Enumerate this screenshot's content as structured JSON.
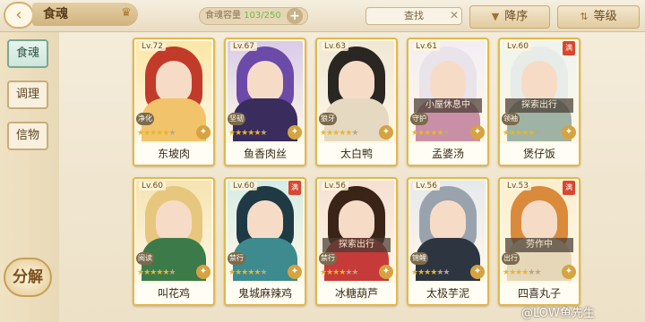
{
  "header": {
    "title": "食魂",
    "capacity_label": "食魂容量",
    "capacity_value": "103/250",
    "search_label": "查找",
    "sort_desc_label": "降序",
    "sort_level_label": "等级"
  },
  "sidebar": {
    "items": [
      {
        "label": "食魂",
        "active": true
      },
      {
        "label": "调理",
        "active": false
      },
      {
        "label": "信物",
        "active": false
      }
    ],
    "decompose_label": "分解"
  },
  "cards": [
    {
      "level": "Lv.72",
      "name": "东坡肉",
      "role": "净化",
      "status": "",
      "tag": "",
      "stars_filled": 5
    },
    {
      "level": "Lv.67",
      "name": "鱼香肉丝",
      "role": "坚韧",
      "status": "",
      "tag": "",
      "stars_filled": 5
    },
    {
      "level": "Lv.63",
      "name": "太白鸭",
      "role": "狼牙",
      "status": "",
      "tag": "",
      "stars_filled": 5
    },
    {
      "level": "Lv.61",
      "name": "孟婆汤",
      "role": "守护",
      "status": "小屋休息中",
      "tag": "",
      "stars_filled": 5
    },
    {
      "level": "Lv.60",
      "name": "煲仔饭",
      "role": "领袖",
      "status": "探索出行",
      "tag": "满",
      "stars_filled": 5
    },
    {
      "level": "Lv.60",
      "name": "叫花鸡",
      "role": "阅读",
      "status": "",
      "tag": "",
      "stars_filled": 5
    },
    {
      "level": "Lv.60",
      "name": "鬼城麻辣鸡",
      "role": "禁行",
      "status": "",
      "tag": "满",
      "stars_filled": 5
    },
    {
      "level": "Lv.56",
      "name": "冰糖葫芦",
      "role": "禁行",
      "status": "探索出行",
      "tag": "",
      "stars_filled": 4
    },
    {
      "level": "Lv.56",
      "name": "太极芋泥",
      "role": "锦鲤",
      "status": "",
      "tag": "",
      "stars_filled": 4
    },
    {
      "level": "Lv.53",
      "name": "四喜丸子",
      "role": "出行",
      "status": "劳作中",
      "tag": "满",
      "stars_filled": 4
    }
  ],
  "watermark": "@LOW鱼先生",
  "icons": {
    "back": "back-arrow-icon",
    "crown": "crown-icon",
    "add": "plus-icon",
    "clear": "close-icon",
    "sort": "sort-arrow-icon",
    "rank": "rank-badge-icon"
  },
  "colors": {
    "card_border": "#e2b84a",
    "active_tab": "#78a895",
    "capacity_num": "#6fb84b"
  }
}
